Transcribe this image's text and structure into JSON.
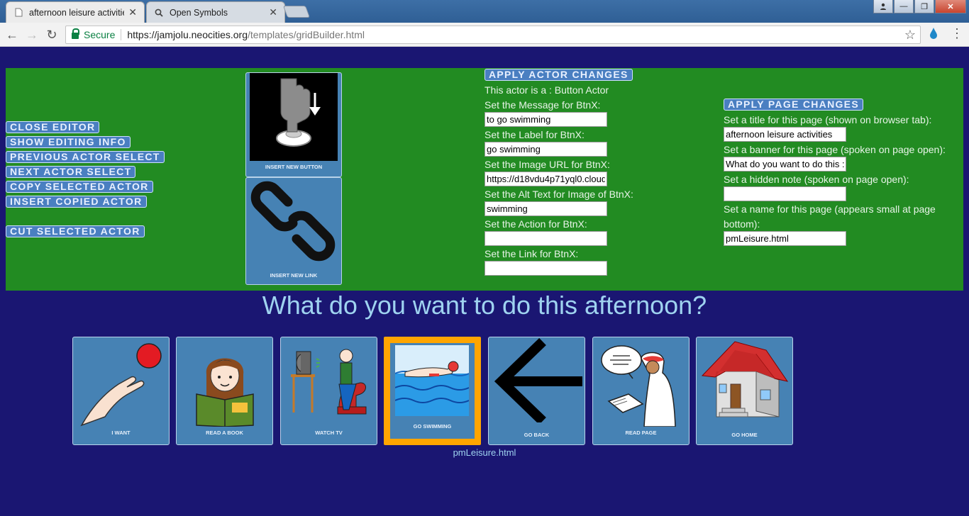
{
  "browser": {
    "tabs": [
      {
        "title": "afternoon leisure activitie",
        "active": true
      },
      {
        "title": "Open Symbols",
        "active": false
      }
    ],
    "url": {
      "secure_label": "Secure",
      "host": "https://jamjolu.neocities.org",
      "path": "/templates/gridBuilder.html"
    }
  },
  "editor": {
    "buttons": [
      "CLOSE EDITOR",
      "SHOW EDITING INFO",
      "PREVIOUS ACTOR SELECT",
      "NEXT ACTOR SELECT",
      "COPY SELECTED ACTOR",
      "INSERT COPIED ACTOR",
      "CUT SELECTED ACTOR"
    ],
    "tools": [
      {
        "label": "INSERT NEW BUTTON",
        "icon": "press-button-icon"
      },
      {
        "label": "INSERT NEW LINK",
        "icon": "chain-link-icon"
      }
    ],
    "actor": {
      "apply_label": "APPLY ACTOR CHANGES",
      "type_text": "This actor is a : Button Actor",
      "message_label": "Set the Message for BtnX:",
      "message_value": "to go swimming",
      "label_label": "Set the Label for BtnX:",
      "label_value": "go swimming",
      "image_label": "Set the Image URL for BtnX:",
      "image_value": "https://d18vdu4p71yql0.cloud",
      "alt_label": "Set the Alt Text for Image of BtnX:",
      "alt_value": "swimming",
      "action_label": "Set the Action for BtnX:",
      "action_value": "",
      "link_label": "Set the Link for BtnX:",
      "link_value": ""
    },
    "page": {
      "apply_label": "APPLY PAGE CHANGES",
      "title_label": "Set a title for this page (shown on browser tab):",
      "title_value": "afternoon leisure activities",
      "banner_label": "Set a banner for this page (spoken on page open):",
      "banner_value": "What do you want to do this :",
      "note_label": "Set a hidden note (spoken on page open):",
      "note_value": "",
      "name_label_1": "Set a name for this page (appears small at page",
      "name_label_2": "bottom):",
      "name_value": "pmLeisure.html"
    }
  },
  "banner": "What do you want to do this afternoon?",
  "tiles": [
    {
      "label": "I WANT",
      "icon": "reaching-hand-icon",
      "selected": false
    },
    {
      "label": "READ A BOOK",
      "icon": "child-reading-icon",
      "selected": false
    },
    {
      "label": "WATCH TV",
      "icon": "person-watching-tv-icon",
      "selected": false
    },
    {
      "label": "GO SWIMMING",
      "icon": "swimmer-icon",
      "selected": true
    },
    {
      "label": "GO BACK",
      "icon": "back-arrow-icon",
      "selected": false
    },
    {
      "label": "READ PAGE",
      "icon": "person-reading-aloud-icon",
      "selected": false
    },
    {
      "label": "GO HOME",
      "icon": "house-icon",
      "selected": false
    }
  ],
  "page_name": "pmLeisure.html",
  "colors": {
    "page_bg": "#1a1672",
    "editor_bg": "#228b22",
    "tile_bg": "#4682b4",
    "selected_border": "#ffa500",
    "banner_text": "#9fd3f0"
  }
}
